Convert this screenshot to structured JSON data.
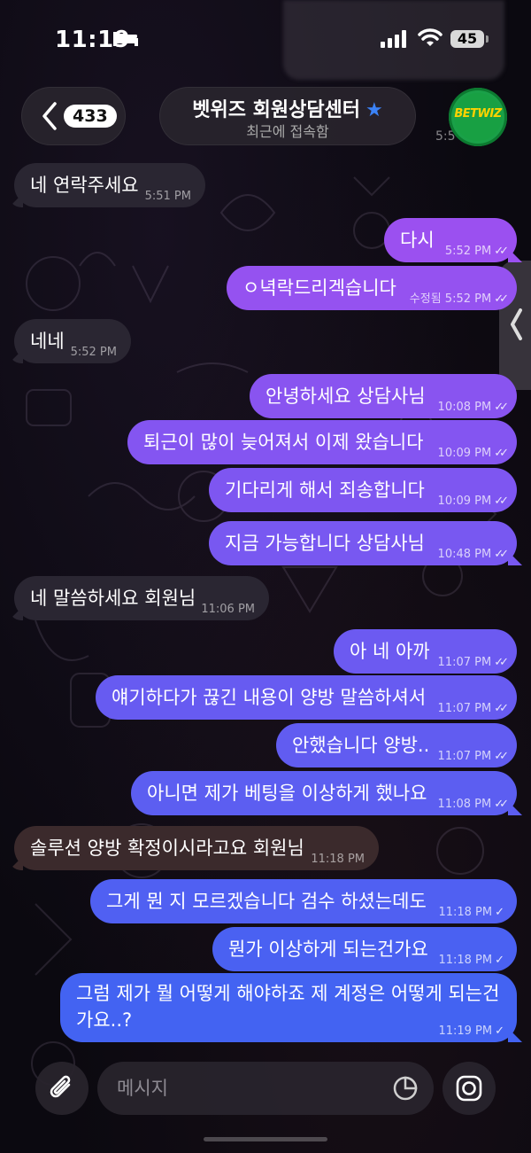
{
  "status_bar": {
    "time": "11:19",
    "battery": "45"
  },
  "header": {
    "back_count": "433",
    "title": "벳위즈 회원상담센터",
    "subtitle": "최근에 접속함",
    "avatar_text": "BETWIZ",
    "peek_time": "5:5"
  },
  "messages": [
    {
      "text": "네 연락주세요",
      "time": "5:51 PM",
      "dir": "in"
    },
    {
      "text": "다시",
      "time": "5:52 PM",
      "dir": "out",
      "read": "double"
    },
    {
      "text": "ㅇ녁락드리겍습니다",
      "time": "수정됨 5:52 PM",
      "dir": "out",
      "read": "double"
    },
    {
      "text": "네네",
      "time": "5:52 PM",
      "dir": "in"
    },
    {
      "text": "안녕하세요 상담사님",
      "time": "10:08 PM",
      "dir": "out",
      "read": "double"
    },
    {
      "text": "퇴근이 많이 늦어져서 이제 왔습니다",
      "time": "10:09 PM",
      "dir": "out",
      "read": "double"
    },
    {
      "text": "기다리게 해서 죄송합니다",
      "time": "10:09 PM",
      "dir": "out",
      "read": "double"
    },
    {
      "text": "지금 가능합니다 상담사님",
      "time": "10:48 PM",
      "dir": "out",
      "read": "double"
    },
    {
      "text": "네 말씀하세요 회원님",
      "time": "11:06 PM",
      "dir": "in"
    },
    {
      "text": "아 네 아까",
      "time": "11:07 PM",
      "dir": "out",
      "read": "double"
    },
    {
      "text": "얘기하다가 끊긴 내용이 양방 말씀하셔서",
      "time": "11:07 PM",
      "dir": "out",
      "read": "double"
    },
    {
      "text": "안했습니다 양방..",
      "time": "11:07 PM",
      "dir": "out",
      "read": "double"
    },
    {
      "text": "아니면 제가 베팅을 이상하게 했나요",
      "time": "11:08 PM",
      "dir": "out",
      "read": "double"
    },
    {
      "text": "솔루션 양방 확정이시라고요 회원님",
      "time": "11:18 PM",
      "dir": "in"
    },
    {
      "text": "그게 뭔 지 모르겠습니다 검수 하셨는데도",
      "time": "11:18 PM",
      "dir": "out",
      "read": "single"
    },
    {
      "text": "뭔가 이상하게 되는건가요",
      "time": "11:18 PM",
      "dir": "out",
      "read": "single"
    },
    {
      "text": "그럼 제가 뭘 어떻게 해야하죠 제 계정은 어떻게 되는건 가요..?",
      "time": "11:19 PM",
      "dir": "out",
      "read": "single"
    }
  ],
  "composer": {
    "placeholder": "메시지"
  },
  "icons": {
    "back": "chevron-left-icon",
    "verified": "star-icon",
    "attach": "paperclip-icon",
    "sticker": "sticker-icon",
    "camera": "camera-icon",
    "side": "chevron-left-icon"
  },
  "colors": {
    "incoming": "#2a2632",
    "incoming_alt": "#3b2a2c",
    "outgoing_top": "#a24ff0",
    "outgoing_bottom": "#3d64f2",
    "accent": "#3b82f6"
  }
}
